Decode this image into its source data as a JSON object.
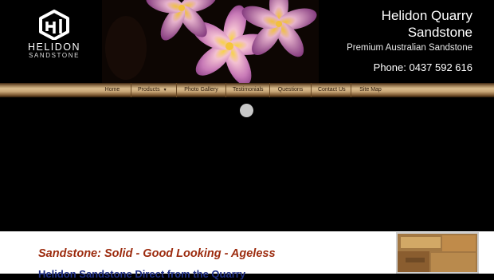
{
  "header": {
    "logo_text": "HELIDON",
    "logo_subtext": "SANDSTONE",
    "company_line1": "Helidon Quarry",
    "company_line2": "Sandstone",
    "tagline": "Premium Australian Sandstone",
    "phone": "Phone: 0437 592 616"
  },
  "nav": {
    "items": [
      "Home",
      "Products",
      "Photo Gallery",
      "Testimonials",
      "Questions",
      "Contact Us",
      "Site Map"
    ],
    "products_caret": "▼"
  },
  "content": {
    "headline": "Sandstone: Solid - Good Looking - Ageless",
    "subhead": "Helidon Sandstone Direct from the Quarry"
  },
  "colors": {
    "headline": "#9c2b0e",
    "subhead": "#1f2f86",
    "nav_gold": "#d9bc8e"
  },
  "icons": {
    "logo": "helidon-cube-logo",
    "slider": "loading-spinner"
  }
}
